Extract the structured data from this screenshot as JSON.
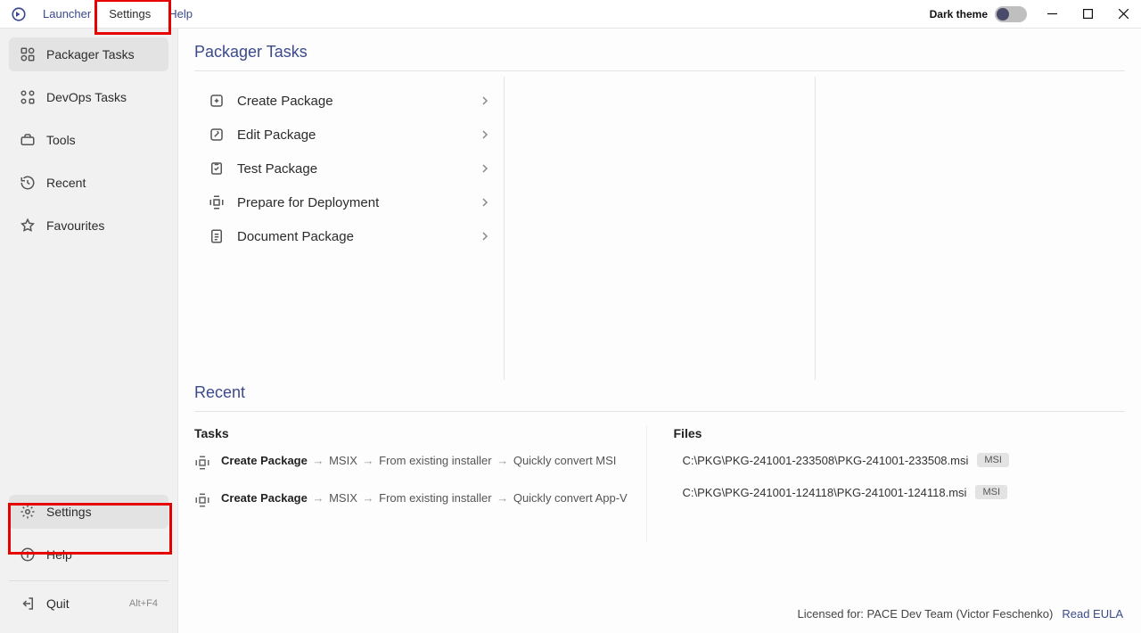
{
  "menu": {
    "brand": "Launcher",
    "settings": "Settings",
    "help": "Help"
  },
  "dark_theme": {
    "label": "Dark theme",
    "on": false
  },
  "sidebar": {
    "items": [
      {
        "label": "Packager Tasks"
      },
      {
        "label": "DevOps Tasks"
      },
      {
        "label": "Tools"
      },
      {
        "label": "Recent"
      },
      {
        "label": "Favourites"
      }
    ],
    "settings": "Settings",
    "help": "Help",
    "quit": "Quit",
    "quit_shortcut": "Alt+F4"
  },
  "main": {
    "title": "Packager Tasks",
    "tasks": [
      {
        "label": "Create Package"
      },
      {
        "label": "Edit Package"
      },
      {
        "label": "Test Package"
      },
      {
        "label": "Prepare for Deployment"
      },
      {
        "label": "Document Package"
      }
    ]
  },
  "recent": {
    "title": "Recent",
    "tasks_heading": "Tasks",
    "files_heading": "Files",
    "tasks": [
      {
        "label": "Create Package",
        "path": [
          "MSIX",
          "From existing installer",
          "Quickly convert MSI"
        ]
      },
      {
        "label": "Create Package",
        "path": [
          "MSIX",
          "From existing installer",
          "Quickly convert App-V"
        ]
      }
    ],
    "files": [
      {
        "path": "C:\\PKG\\PKG-241001-233508\\PKG-241001-233508.msi",
        "badge": "MSI"
      },
      {
        "path": "C:\\PKG\\PKG-241001-124118\\PKG-241001-124118.msi",
        "badge": "MSI"
      }
    ]
  },
  "footer": {
    "license": "Licensed for: PACE Dev Team (Victor Feschenko)",
    "eula": "Read EULA"
  }
}
